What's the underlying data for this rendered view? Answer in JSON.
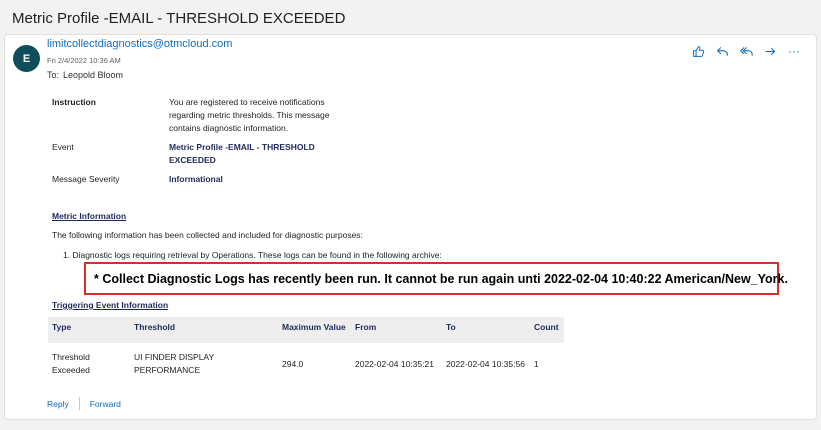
{
  "subject": "Metric Profile  -EMAIL - THRESHOLD EXCEEDED",
  "message": {
    "avatar_initial": "E",
    "sender": "limitcollectdiagnostics@otmcloud.com",
    "date": "Fri 2/4/2022 10:36 AM",
    "to_label": "To:",
    "to": "Leopold Bloom"
  },
  "actions": [
    {
      "name": "like",
      "icon": "thumbs-up-icon"
    },
    {
      "name": "reply",
      "icon": "reply-icon"
    },
    {
      "name": "reply-all",
      "icon": "reply-all-icon"
    },
    {
      "name": "forward",
      "icon": "forward-icon"
    },
    {
      "name": "more",
      "icon": "more-icon",
      "label": "···"
    }
  ],
  "details": {
    "instruction_label": "Instruction",
    "instruction_value": "You are registered to receive notifications regarding metric thresholds. This message contains diagnostic information.",
    "event_label": "Event",
    "event_value": "Metric Profile -EMAIL - THRESHOLD EXCEEDED",
    "severity_label": "Message Severity",
    "severity_value": "Informational"
  },
  "metric_info": {
    "title": "Metric Information",
    "intro": "The following information has been collected and included for diagnostic purposes:",
    "item1": "1. Diagnostic logs requiring retrieval by Operations. These logs can be found in the following archive:"
  },
  "alert": "*  Collect Diagnostic Logs has recently been run.  It cannot be run again unti 2022-02-04 10:40:22 American/New_York.",
  "triggering": {
    "title": "Triggering Event Information",
    "headers": [
      "Type",
      "Threshold",
      "Maximum Value",
      "From",
      "To",
      "Count"
    ],
    "row": [
      "Threshold Exceeded",
      "UI FINDER DISPLAY PERFORMANCE",
      "294.0",
      "2022-02-04 10:35:21",
      "2022-02-04 10:35:56",
      "1"
    ]
  },
  "footer": {
    "reply": "Reply",
    "forward": "Forward"
  },
  "colors": {
    "link": "#0f6cbd",
    "avatar": "#0f4c5c",
    "navy": "#1f2a5c",
    "alert_border": "#d32f2f"
  }
}
